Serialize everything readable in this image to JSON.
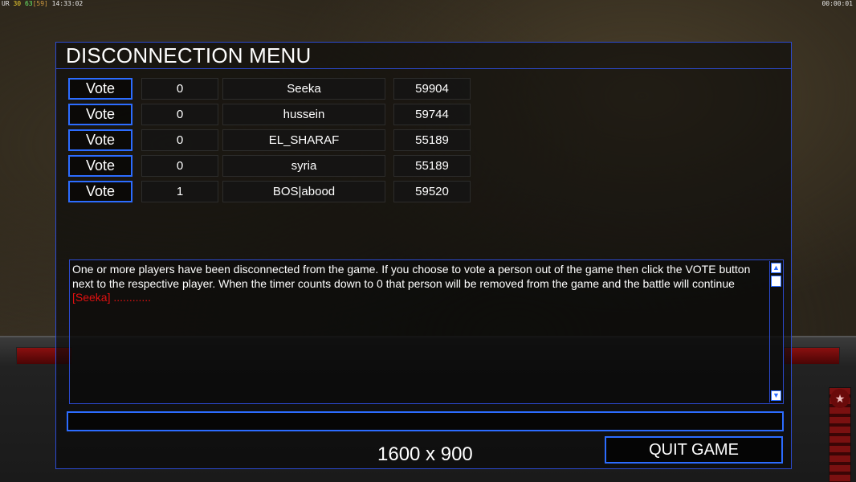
{
  "hud": {
    "left_prefix": "UR",
    "left_a": "30",
    "left_b": "63",
    "left_c": "[59]",
    "left_time": "14:33:02",
    "right_time": "00:00:01"
  },
  "dialog": {
    "title": "DISCONNECTION MENU",
    "vote_label": "Vote",
    "players": [
      {
        "votes": "0",
        "name": "Seeka",
        "id": "59904"
      },
      {
        "votes": "0",
        "name": "hussein",
        "id": "59744"
      },
      {
        "votes": "0",
        "name": "EL_SHARAF",
        "id": "55189"
      },
      {
        "votes": "0",
        "name": "syria",
        "id": "55189"
      },
      {
        "votes": "1",
        "name": "BOS|abood",
        "id": "59520"
      }
    ],
    "chat": {
      "message": "One or more players have been disconnected from the game. If you choose to vote a person out of the game then click the VOTE button next to the respective player. When the timer counts down to 0 that person will be removed from the game and the battle will continue",
      "line2": "[Seeka] ............",
      "message_color": "#ffffff",
      "line2_color": "#e01010"
    },
    "chat_input_value": "",
    "resolution": "1600 x 900",
    "quit_label": "QUIT GAME"
  },
  "colors": {
    "accent_border": "#2c6cff"
  }
}
